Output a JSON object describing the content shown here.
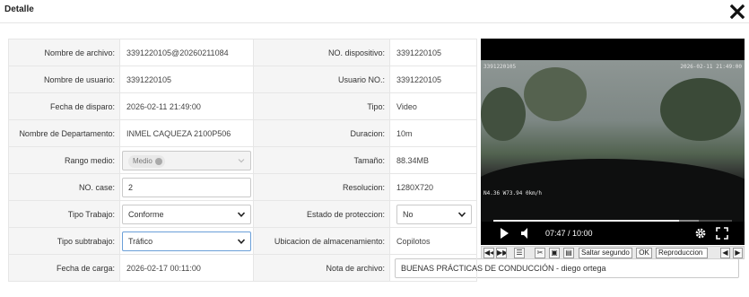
{
  "modal": {
    "title": "Detalle",
    "close_icon": "close-x-icon"
  },
  "fields": {
    "file_name": {
      "label": "Nombre de archivo:",
      "value": "3391220105@20260211084"
    },
    "device_no": {
      "label": "NO. dispositivo:",
      "value": "3391220105"
    },
    "user_name": {
      "label": "Nombre de usuario:",
      "value": "3391220105"
    },
    "user_no": {
      "label": "Usuario NO.:",
      "value": "3391220105"
    },
    "trigger_date": {
      "label": "Fecha de disparo:",
      "value": "2026-02-11 21:49:00"
    },
    "type": {
      "label": "Tipo:",
      "value": "Video"
    },
    "department": {
      "label": "Nombre de Departamento:",
      "value": "INMEL CAQUEZA 2100P506"
    },
    "duration": {
      "label": "Duracion:",
      "value": "10m"
    },
    "middle_range": {
      "label": "Rango medio:",
      "chip": "Medio"
    },
    "size": {
      "label": "Tamaño:",
      "value": "88.34MB"
    },
    "case_no": {
      "label": "NO. case:",
      "value": "2"
    },
    "resolution": {
      "label": "Resolucion:",
      "value": "1280X720"
    },
    "work_type": {
      "label": "Tipo Trabajo:",
      "selected": "Conforme"
    },
    "protection_state": {
      "label": "Estado de proteccion:",
      "selected": "No"
    },
    "work_subtype": {
      "label": "Tipo subtrabajo:",
      "selected": "Tráfico"
    },
    "storage_location": {
      "label": "Ubicacion de almacenamiento:",
      "value": "Copilotos"
    },
    "upload_date": {
      "label": "Fecha de carga:",
      "value": "2026-02-17 00:11:00"
    },
    "file_note": {
      "label": "Nota de archivo:",
      "value": "BUENAS PRÁCTICAS DE CONDUCCIÓN - diego ortega"
    }
  },
  "video": {
    "osd_top_left": "3391220105",
    "osd_top_right": "2026-02-11 21:49:00",
    "osd_bottom_left": "N4.36 W73.94 0km/h",
    "time_display": "07:47 / 10:00",
    "progress": 0.778,
    "buffered": 0.86
  },
  "toolbar": {
    "skip_input_placeholder": "Saltar segundo",
    "ok_label": "OK",
    "playback_input_placeholder": "Reproduccion"
  }
}
